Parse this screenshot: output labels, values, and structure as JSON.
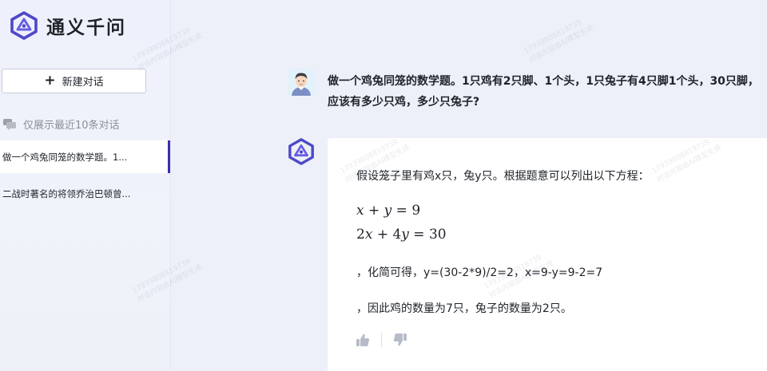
{
  "app": {
    "name": "通义千问",
    "brand_color": "#4e48c8"
  },
  "sidebar": {
    "new_chat_label": "新建对话",
    "history_hint": "仅展示最近10条对话",
    "conversations": [
      {
        "title": "做一个鸡兔同笼的数学题。1...",
        "active": true
      },
      {
        "title": "二战时著名的将领乔治巴顿曾...",
        "active": false
      }
    ]
  },
  "chat": {
    "user_message": "做一个鸡兔同笼的数学题。1只鸡有2只脚、1个头，1只兔子有4只脚1个头，30只脚，应该有多少只鸡，多少只兔子?",
    "answer": {
      "intro": "假设笼子里有鸡x只，兔y只。根据题意可以列出以下方程：",
      "equation_1": "x + y = 9",
      "equation_2": "2x + 4y = 30",
      "simplify": "，化简可得，y=(30-2*9)/2=2，x=9-y=9-2=7",
      "conclusion": "，因此鸡的数量为7只，兔子的数量为2只。"
    }
  },
  "watermark": {
    "line_1": "17939808819739",
    "line_2": "对话内容由AI模型生成"
  }
}
